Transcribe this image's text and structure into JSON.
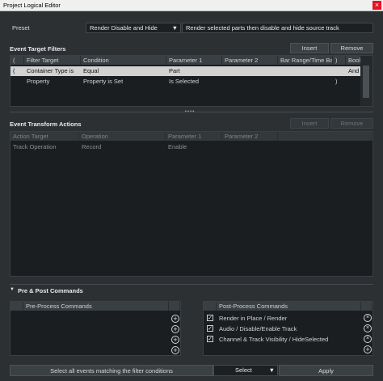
{
  "window": {
    "title": "Project Logical Editor",
    "close": "×"
  },
  "preset": {
    "label": "Preset",
    "value": "Render Disable and Hide",
    "dropdown_arrow": "▼",
    "description": "Render selected parts then disable and hide source track"
  },
  "filters": {
    "title": "Event Target Filters",
    "insert": "Insert",
    "remove": "Remove",
    "columns": [
      "(",
      "Filter Target",
      "Condition",
      "Parameter 1",
      "Parameter 2",
      "Bar Range/Time Base",
      ")",
      "Bool"
    ],
    "rows": [
      {
        "open": "(",
        "target": "Container Type is",
        "condition": "Equal",
        "p1": "Part",
        "p2": "",
        "range": "",
        "close": "",
        "bool": "And"
      },
      {
        "open": "",
        "target": "Property",
        "condition": "Property is Set",
        "p1": "Is Selected",
        "p2": "",
        "range": "",
        "close": ")",
        "bool": ""
      }
    ]
  },
  "splitter": "• • • •",
  "actions": {
    "title": "Event Transform Actions",
    "insert": "Insert",
    "remove": "Remove",
    "columns": [
      "Action Target",
      "Operation",
      "Parameter 1",
      "Parameter 2"
    ],
    "rows": [
      {
        "target": "Track Operation",
        "operation": "Record",
        "p1": "Enable",
        "p2": ""
      }
    ]
  },
  "prepost": {
    "toggle": "▼",
    "title": "Pre & Post Commands",
    "pre_header": "Pre-Process Commands",
    "post_header": "Post-Process Commands",
    "post_items": [
      {
        "checked": "✓",
        "label": "Render in Place / Render",
        "remove": "×"
      },
      {
        "checked": "✓",
        "label": "Audio / Disable/Enable Track",
        "remove": "×"
      },
      {
        "checked": "✓",
        "label": "Channel & Track Visibility / HideSelected",
        "remove": "×"
      }
    ],
    "add": "+"
  },
  "footer": {
    "select_info": "Select all events matching the filter conditions",
    "select_value": "Select",
    "select_arrow": "▼",
    "apply": "Apply"
  },
  "colors": {
    "background": "#2c3033",
    "grid": "#1b1e20",
    "selected_row": "#d2d2d2",
    "close_button": "#e81123"
  }
}
